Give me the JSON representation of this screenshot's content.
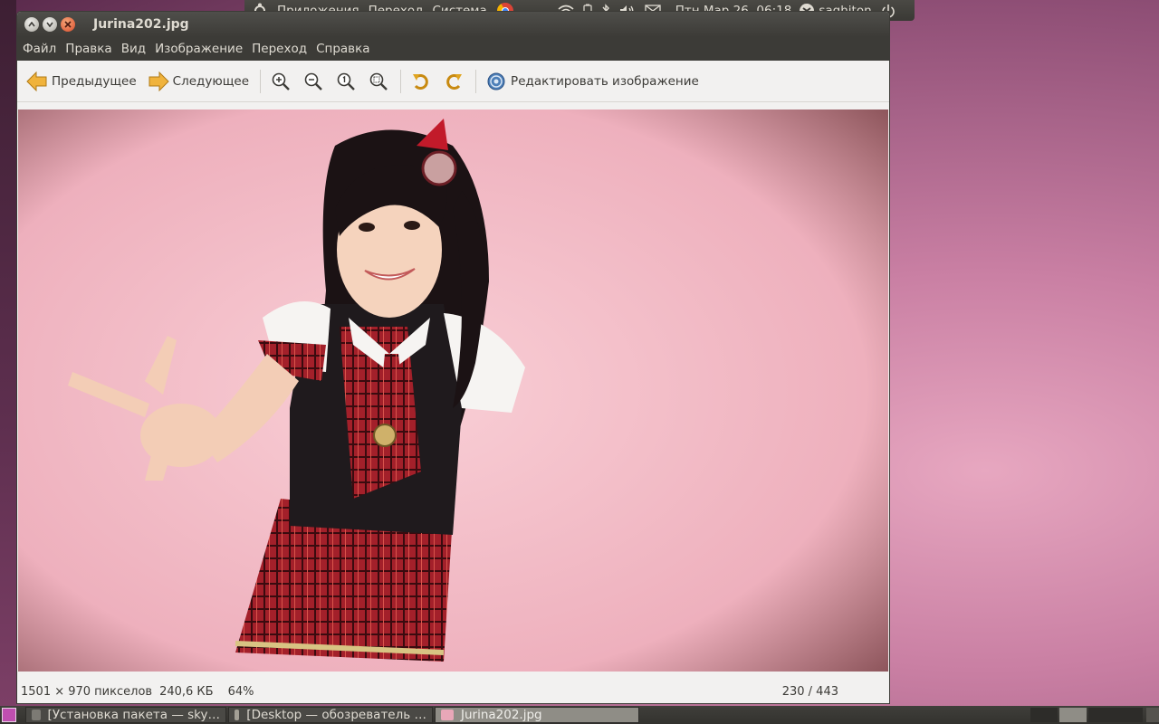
{
  "top_panel": {
    "menus": [
      "Приложения",
      "Переход",
      "Система"
    ],
    "clock": "Птн Мар 26, 06:18",
    "user": "saghiton",
    "icons": [
      "ubuntu-logo-icon",
      "chrome-icon",
      "wifi-icon",
      "battery-icon",
      "bluetooth-icon",
      "volume-icon",
      "mail-icon",
      "user-icon",
      "power-icon"
    ]
  },
  "window": {
    "title": "Jurina202.jpg",
    "menu": [
      "Файл",
      "Правка",
      "Вид",
      "Изображение",
      "Переход",
      "Справка"
    ],
    "toolbar": {
      "prev_label": "Предыдущее",
      "next_label": "Следующее",
      "edit_label": "Редактировать изображение",
      "icons": [
        "zoom-in-icon",
        "zoom-out-icon",
        "zoom-normal-icon",
        "zoom-fit-icon",
        "rotate-left-icon",
        "rotate-right-icon"
      ]
    },
    "status": {
      "dimensions": "1501 × 970 пикселов",
      "size": "240,6 КБ",
      "zoom": "64%",
      "position": "230 / 443"
    }
  },
  "taskbar": {
    "items": [
      {
        "label": "[Установка пакета — sky…",
        "active": false
      },
      {
        "label": "[Desktop — обозреватель …",
        "active": false
      },
      {
        "label": "Jurina202.jpg",
        "active": true
      }
    ]
  },
  "colors": {
    "accent": "#f07746",
    "panel": "#3c3b37",
    "photo_bg": "#f7c8cf"
  }
}
